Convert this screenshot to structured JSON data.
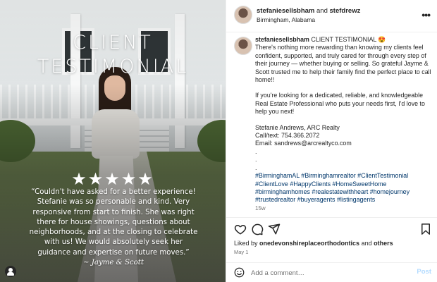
{
  "media": {
    "title_line1": "CLIENT",
    "title_line2": "TESTIMONIAL",
    "stars": "★★★★★",
    "quote": "“Couldn't have asked for a better experience! Stefanie was so personable and kind. Very responsive from start to finish. She was right there for house showings, questions about neighborhoods, and at the closing to celebrate with us! We would absolutely seek her guidance and expertise on future moves.”",
    "signature": "~ Jayme & Scott"
  },
  "header": {
    "user1": "stefaniesellsbham",
    "joiner": " and ",
    "user2": "stefdrewz",
    "location": "Birmingham, Alabama"
  },
  "caption": {
    "username": "stefaniesellsbham",
    "headline": " CLIENT TESTIMONIAL 😍",
    "p1": "There's nothing more rewarding than knowing my clients feel confident, supported, and truly cared for through every step of their journey — whether buying or selling. So grateful Jayme & Scott trusted me to help their family find the perfect place to call home!!",
    "p2": "If you're looking for a dedicated, reliable, and knowledgeable Real Estate Professional who puts your needs first, I'd love to help you next!",
    "contact_name": "Stefanie Andrews, ARC Realty",
    "contact_phone": "Call/text: 754.366.2072",
    "contact_email": "Email: sandrews@arcrealtyco.com",
    "dot1": ".",
    "dot2": ".",
    "dot3": ".",
    "hashtags": "#BirminghamAL #Birminghamrealtor #ClientTestimonial #ClientLove #HappyClients #HomeSweetHome #birminghamhomes #realestatewithheart #homejourney #trustedrealtor #buyeragents #listingagents",
    "age": "15w"
  },
  "likes": {
    "prefix": "Liked by ",
    "user": "onedevonshireplaceorthodontics",
    "and": " and ",
    "others": "others"
  },
  "date": "May 1",
  "comment": {
    "placeholder": "Add a comment…",
    "post_label": "Post"
  },
  "icons": {
    "like": "heart-icon",
    "comment": "comment-icon",
    "share": "share-icon",
    "save": "bookmark-icon",
    "more": "more-icon",
    "emoji": "emoji-icon",
    "tags": "user-tag-icon"
  },
  "colors": {
    "hashtag": "#00376b",
    "muted": "#737373",
    "post_button": "#b3dbff"
  }
}
